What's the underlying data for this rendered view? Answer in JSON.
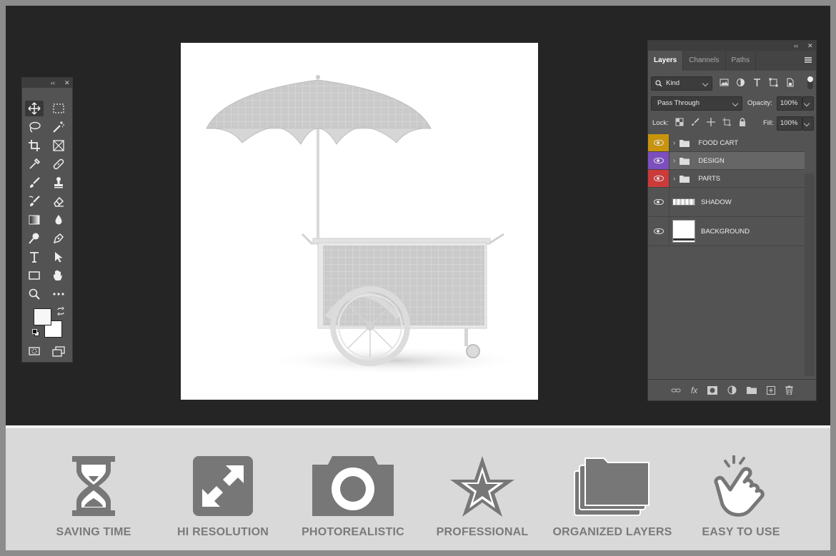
{
  "tools_panel": {
    "collapse_label": "‹‹",
    "close_label": "✕",
    "tools": [
      "move-icon",
      "marquee-icon",
      "lasso-icon",
      "magic-wand-icon",
      "crop-icon",
      "frame-icon",
      "eyedropper-icon",
      "healing-icon",
      "brush-icon",
      "stamp-icon",
      "history-brush-icon",
      "eraser-icon",
      "gradient-icon",
      "blur-icon",
      "dodge-icon",
      "pen-icon",
      "type-icon",
      "path-select-icon",
      "rectangle-icon",
      "hand-icon",
      "zoom-icon",
      "more-icon"
    ]
  },
  "layers_panel": {
    "collapse_label": "‹‹",
    "close_label": "✕",
    "tabs": [
      {
        "label": "Layers"
      },
      {
        "label": "Channels"
      },
      {
        "label": "Paths"
      }
    ],
    "filter": {
      "value": "Kind"
    },
    "blend_mode": {
      "value": "Pass Through"
    },
    "opacity": {
      "label": "Opacity:",
      "value": "100%"
    },
    "lock_label": "Lock:",
    "fill": {
      "label": "Fill:",
      "value": "100%"
    },
    "layers": [
      {
        "name": "FOOD CART",
        "color": "#c8940c",
        "type": "group"
      },
      {
        "name": "DESIGN",
        "color": "#7d4fbe",
        "type": "group"
      },
      {
        "name": "PARTS",
        "color": "#cc3a3a",
        "type": "group"
      },
      {
        "name": "SHADOW",
        "type": "layer"
      },
      {
        "name": "BACKGROUND",
        "type": "layer"
      }
    ],
    "footer_icons": [
      "link-icon",
      "fx-icon",
      "mask-icon",
      "adjustment-icon",
      "folder-icon",
      "new-layer-icon",
      "trash-icon"
    ],
    "fx_label": "fx"
  },
  "features": [
    {
      "label": "SAVING TIME",
      "icon": "hourglass-icon"
    },
    {
      "label": "HI RESOLUTION",
      "icon": "expand-icon"
    },
    {
      "label": "PHOTOREALISTIC",
      "icon": "camera-icon"
    },
    {
      "label": "PROFESSIONAL",
      "icon": "star-icon"
    },
    {
      "label": "ORGANIZED LAYERS",
      "icon": "layers-icon"
    },
    {
      "label": "EASY TO USE",
      "icon": "hand-tap-icon"
    }
  ]
}
